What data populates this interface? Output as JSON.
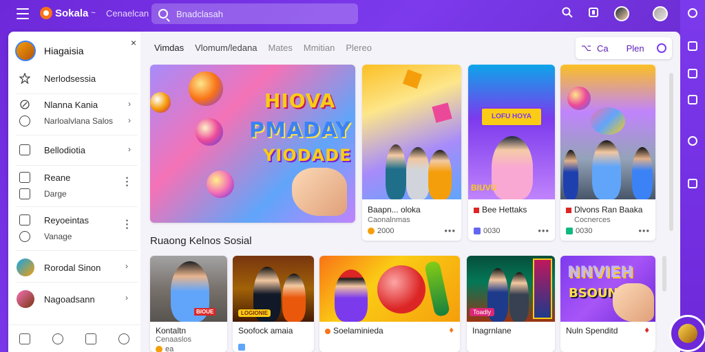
{
  "app": {
    "name": "Sokala",
    "caret": "~",
    "nav_link": "Cenaelcan"
  },
  "search": {
    "placeholder": "Bnadclasah"
  },
  "sidebar": {
    "profile_name": "Hiagaisia",
    "close": "×",
    "items": [
      {
        "label": "Nerlodsessia"
      },
      {
        "label": "Nlanna Kania",
        "sub": "Narloalvlana Salos"
      },
      {
        "label": "Bellodiotia"
      },
      {
        "label": "Reane",
        "sub": "Darge"
      },
      {
        "label": "Reyoeintas",
        "sub": "Vanage"
      },
      {
        "label": "Rorodal Sinon"
      },
      {
        "label": "Nagoadsann"
      }
    ]
  },
  "tabs": [
    "Vimdas",
    "Vlomum/ledana",
    "Mates",
    "Mmitian",
    "Plereo"
  ],
  "actions": {
    "a": "Ca",
    "b": "Plen"
  },
  "hero": {
    "line1": "HIOVA",
    "line2": "PMADAY",
    "line3": "YIODADE"
  },
  "top_cards": [
    {
      "title": "Baapn... oloka",
      "meta": "Caonalnmas",
      "stat": "2000",
      "more": "•••"
    },
    {
      "title": "Bee Hettaks",
      "meta": "",
      "stat": "0030",
      "more": "•••",
      "overlay": "BIUVU"
    },
    {
      "title": "Dlvons Ran Baaka",
      "meta": "Cocnerces",
      "stat": "0030",
      "more": "•••"
    }
  ],
  "card2_banner": "LOFU HOYA",
  "section_title": "Ruaong Kelnos Sosial",
  "bottom_cards": [
    {
      "title": "Kontaltn",
      "meta": "Cenaaslos",
      "stat": "ea",
      "badge": "BIOUE"
    },
    {
      "title": "Soofock amaia",
      "meta": "",
      "stat": "",
      "badge": "LOGIONIE"
    },
    {
      "title": "Soelaminieda",
      "meta": "",
      "stat": ""
    },
    {
      "title": "Inagrnlane",
      "meta": "",
      "stat": "",
      "badge": "Toadly"
    },
    {
      "title": "Nuln Spenditd",
      "meta": "",
      "stat": "",
      "banner1": "NNVIEH",
      "banner2": "BSOUN"
    }
  ],
  "colors": {
    "accent": "#7c3aed",
    "brand": "#6d28d9",
    "logo": "#f97316"
  }
}
